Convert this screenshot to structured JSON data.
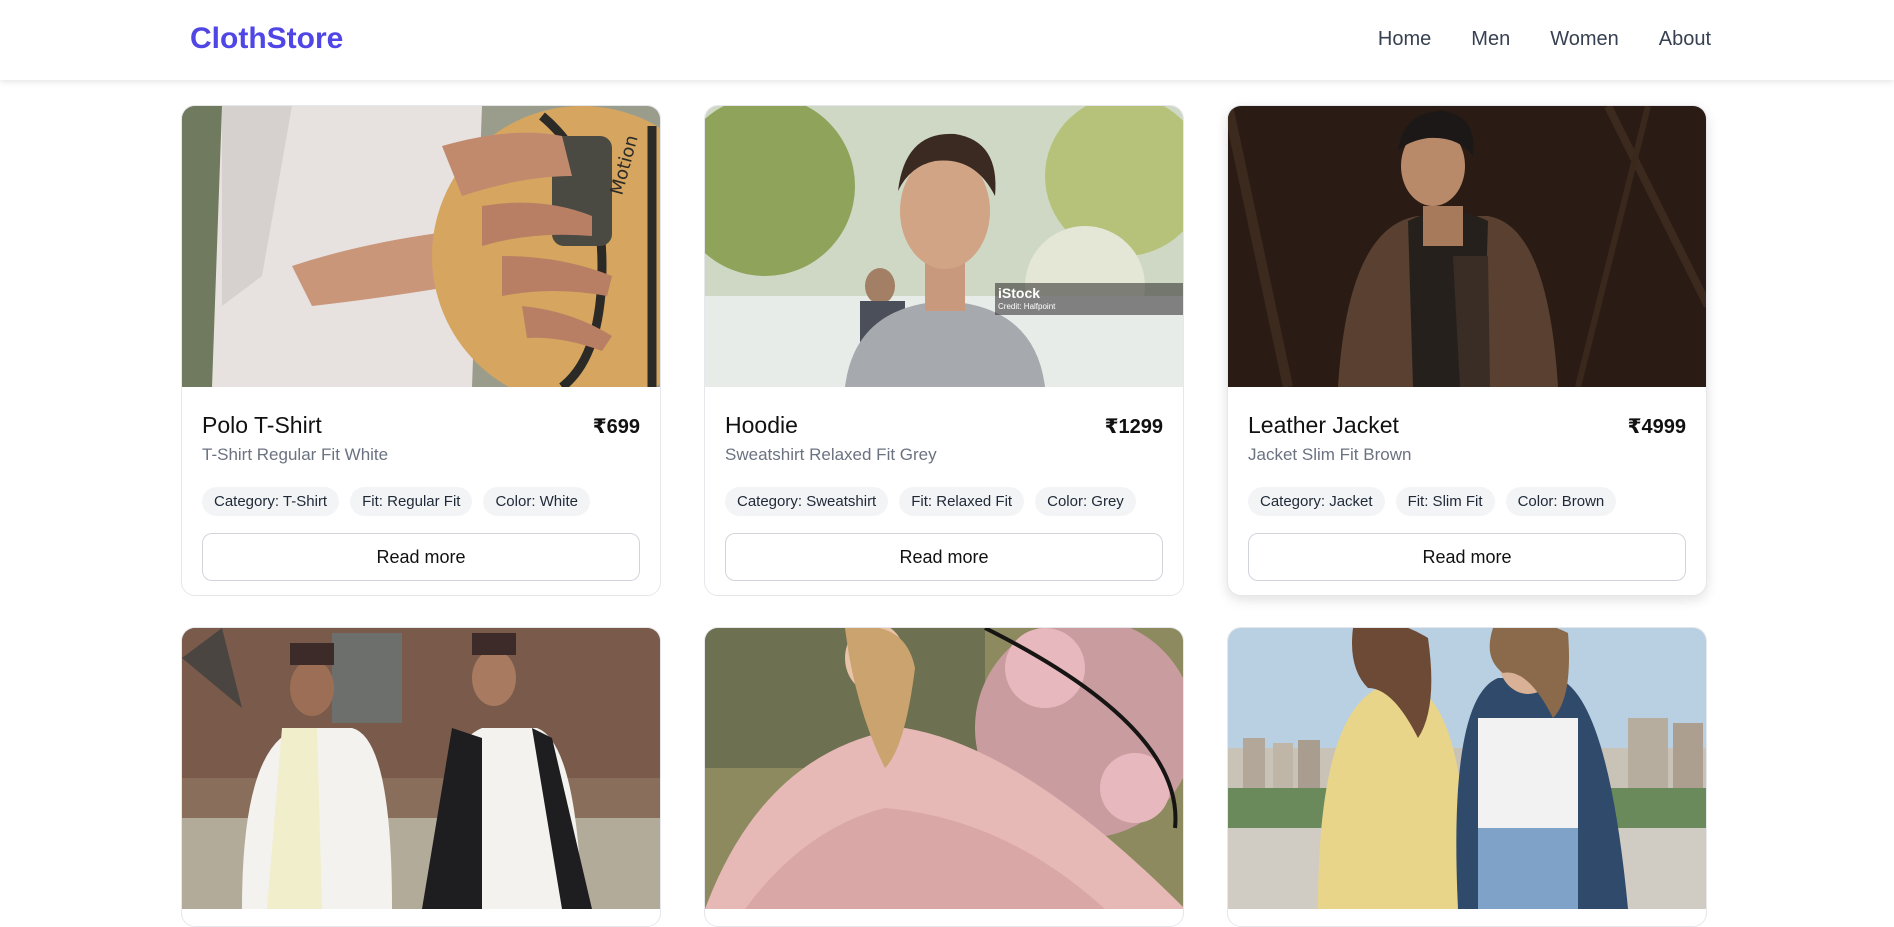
{
  "brand": "ClothStore",
  "nav": [
    "Home",
    "Men",
    "Women",
    "About"
  ],
  "products": [
    {
      "title": "Polo T-Shirt",
      "price": "₹699",
      "subtitle": "T-Shirt Regular Fit White",
      "tags": [
        "Category: T-Shirt",
        "Fit: Regular Fit",
        "Color: White"
      ],
      "button": "Read more"
    },
    {
      "title": "Hoodie",
      "price": "₹1299",
      "subtitle": "Sweatshirt Relaxed Fit Grey",
      "tags": [
        "Category: Sweatshirt",
        "Fit: Relaxed Fit",
        "Color: Grey"
      ],
      "button": "Read more",
      "watermark": {
        "brand": "iStock",
        "credit": "Credit: Halfpoint"
      }
    },
    {
      "title": "Leather Jacket",
      "price": "₹4999",
      "subtitle": "Jacket Slim Fit Brown",
      "tags": [
        "Category: Jacket",
        "Fit: Slim Fit",
        "Color: Brown"
      ],
      "button": "Read more"
    }
  ],
  "basketball_print": "Motion",
  "colors": {
    "brand": "#4f46e5",
    "text": "#111111",
    "muted": "#6b7280",
    "tag_bg": "#f3f4f6",
    "border": "#e5e7eb"
  }
}
